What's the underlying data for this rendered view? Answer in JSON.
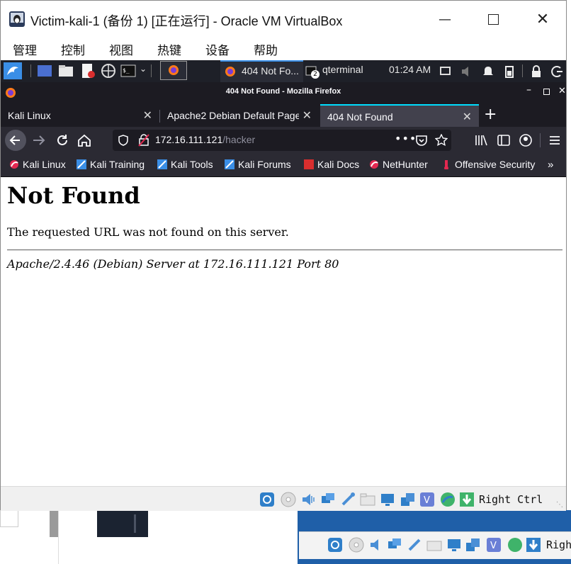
{
  "vbox": {
    "title": "Victim-kali-1 (备份 1) [正在运行] - Oracle VM VirtualBox",
    "menu": [
      "管理",
      "控制",
      "视图",
      "热键",
      "设备",
      "帮助"
    ],
    "host_key": "Right Ctrl",
    "host_key_partial": "Righ"
  },
  "kali_panel": {
    "task_firefox": "404 Not Fo...",
    "task_terminal": "qterminal",
    "terminal_count": "2",
    "clock": "01:24 AM"
  },
  "firefox": {
    "window_title": "404 Not Found - Mozilla Firefox",
    "tabs": [
      {
        "label": "Kali Linux",
        "active": false
      },
      {
        "label": "Apache2 Debian Default Page",
        "active": false
      },
      {
        "label": "404 Not Found",
        "active": true
      }
    ],
    "url_host": "172.16.111.121",
    "url_path": "/hacker",
    "bookmarks": [
      "Kali Linux",
      "Kali Training",
      "Kali Tools",
      "Kali Forums",
      "Kali Docs",
      "NetHunter",
      "Offensive Security"
    ]
  },
  "page": {
    "heading": "Not Found",
    "message": "The requested URL was not found on this server.",
    "address": "Apache/2.4.46 (Debian) Server at 172.16.111.121 Port 80"
  },
  "colors": {
    "firefox_dark": "#1c1b22",
    "firefox_toolbar": "#2b2a33",
    "active_tab_accent": "#00ddff",
    "kali_panel": "#1e2028"
  }
}
